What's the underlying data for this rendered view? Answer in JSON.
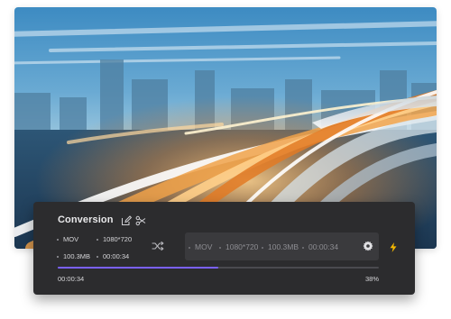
{
  "panel": {
    "title": "Conversion",
    "icons": {
      "edit": "edit-icon",
      "cut": "scissors-icon",
      "convert": "shuffle-icon",
      "settings": "gear-icon",
      "accelerate": "lightning-icon"
    },
    "source": {
      "format": "MOV",
      "resolution": "1080*720",
      "size": "100.3MB",
      "duration": "00:00:34"
    },
    "output": {
      "format": "MOV",
      "resolution": "1080*720",
      "size": "100.3MB",
      "duration": "00:00:34"
    },
    "progress": {
      "elapsed": "00:00:34",
      "percent_label": "38%",
      "fraction": 0.5
    }
  },
  "colors": {
    "panel_bg": "#2c2c2e",
    "accent": "#7b61ff",
    "bolt": "#f5b800"
  }
}
